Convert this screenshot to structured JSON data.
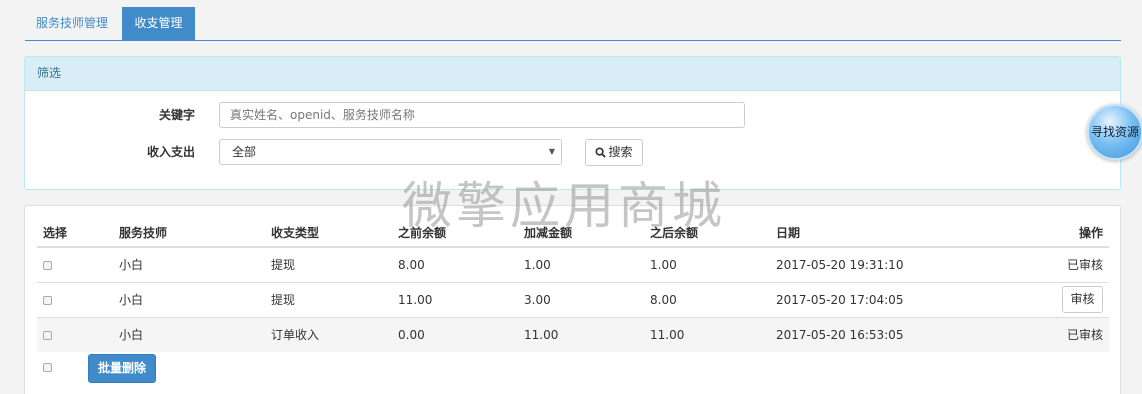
{
  "tabs": [
    {
      "label": "服务技师管理"
    },
    {
      "label": "收支管理"
    }
  ],
  "filter": {
    "heading": "筛选",
    "keyword_label": "关键字",
    "keyword_placeholder": "真实姓名、openid、服务技师名称",
    "keyword_value": "",
    "io_label": "收入支出",
    "io_selected": "全部",
    "search_button": "搜索"
  },
  "table": {
    "headers": [
      "选择",
      "服务技师",
      "收支类型",
      "之前余额",
      "加减金额",
      "之后余额",
      "日期",
      "操作"
    ],
    "rows": [
      {
        "technician": "小白",
        "type": "提现",
        "before": "8.00",
        "change": "1.00",
        "after": "1.00",
        "date": "2017-05-20 19:31:10",
        "action": "已审核"
      },
      {
        "technician": "小白",
        "type": "提现",
        "before": "11.00",
        "change": "3.00",
        "after": "8.00",
        "date": "2017-05-20 17:04:05",
        "action": "审核"
      },
      {
        "technician": "小白",
        "type": "订单收入",
        "before": "0.00",
        "change": "11.00",
        "after": "11.00",
        "date": "2017-05-20 16:53:05",
        "action": "已审核"
      }
    ],
    "bulk_delete": "批量删除"
  },
  "watermark": "微擎应用商城",
  "float_button": "寻找资源",
  "colors": {
    "primary": "#428bca",
    "info_bg": "#d9edf7",
    "info_text": "#31708f",
    "body_bg": "#f3f3f4"
  },
  "icons": {
    "search": "search-icon",
    "caret": "caret-down-icon"
  }
}
